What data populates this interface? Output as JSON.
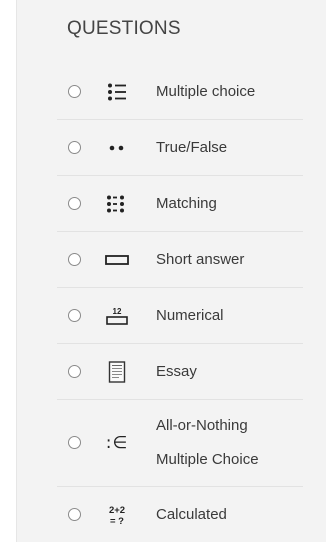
{
  "panel": {
    "heading": "QUESTIONS"
  },
  "questions": [
    {
      "label": "Multiple choice",
      "icon": "multiple-choice-icon"
    },
    {
      "label": "True/False",
      "icon": "true-false-icon"
    },
    {
      "label": "Matching",
      "icon": "matching-icon"
    },
    {
      "label": "Short answer",
      "icon": "short-answer-icon"
    },
    {
      "label": "Numerical",
      "icon": "numerical-icon",
      "icon_text": "12"
    },
    {
      "label": "Essay",
      "icon": "essay-icon"
    },
    {
      "label_lines": [
        "All-or-Nothing",
        "Multiple Choice"
      ],
      "icon": "all-or-nothing-icon",
      "icon_text": ":∈"
    },
    {
      "label": "Calculated",
      "icon": "calculated-icon",
      "icon_text_top": "2+2",
      "icon_text_bottom": "= ?"
    }
  ]
}
